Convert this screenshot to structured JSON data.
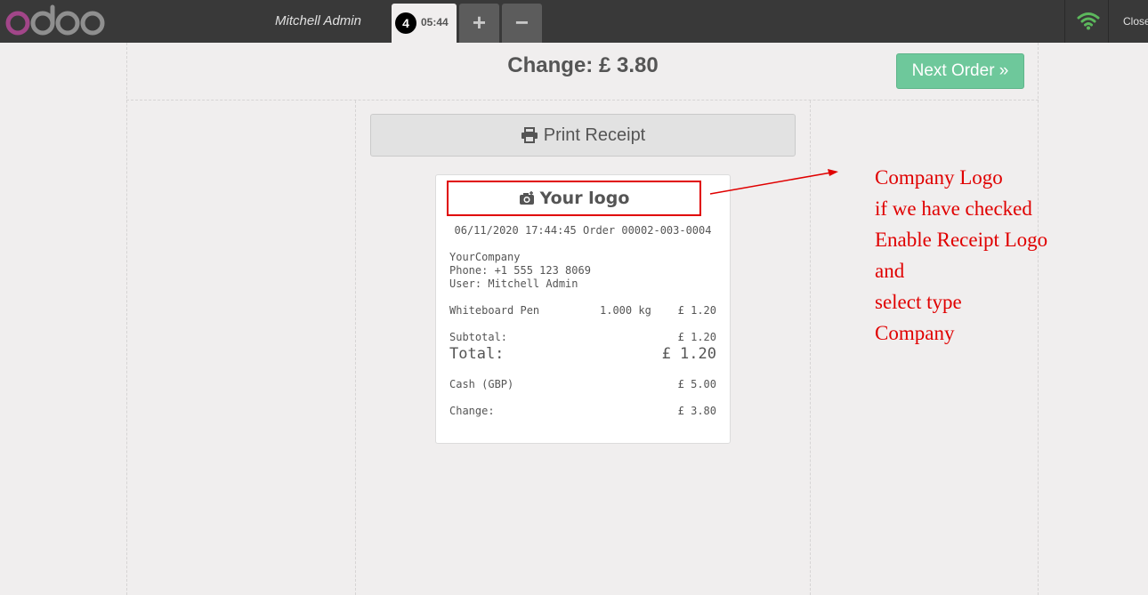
{
  "header": {
    "brand": "odoo",
    "cashier": "Mitchell Admin",
    "order_tab": {
      "number": "4",
      "time": "05:44"
    },
    "add_order_label": "+",
    "remove_order_label": "−",
    "close_label": "Close"
  },
  "screen": {
    "change_title": "Change: £ 3.80",
    "next_order_label": "Next Order »",
    "print_receipt_label": "Print Receipt"
  },
  "receipt": {
    "logo_label": "Your logo",
    "date_order": "06/11/2020 17:44:45 Order 00002-003-0004",
    "company": "YourCompany",
    "phone": "Phone: +1 555 123 8069",
    "user": "User: Mitchell Admin",
    "lines": [
      {
        "product": "Whiteboard Pen",
        "qty": "1.000 kg",
        "price": "£ 1.20"
      }
    ],
    "subtotal_label": "Subtotal:",
    "subtotal_value": "£ 1.20",
    "total_label": "Total:",
    "total_value": "£ 1.20",
    "payment_label": "Cash (GBP)",
    "payment_value": "£ 5.00",
    "change_label": "Change:",
    "change_value": "£ 3.80"
  },
  "annotation": {
    "lines": [
      "Company Logo",
      "if we have checked",
      "Enable Receipt Logo",
      "and",
      "select type",
      "Company"
    ],
    "color": "#e00000"
  },
  "colors": {
    "topbar": "#393939",
    "background": "#f0eeee",
    "next_order": "#6ec89b",
    "brand_o": "#a24689"
  }
}
